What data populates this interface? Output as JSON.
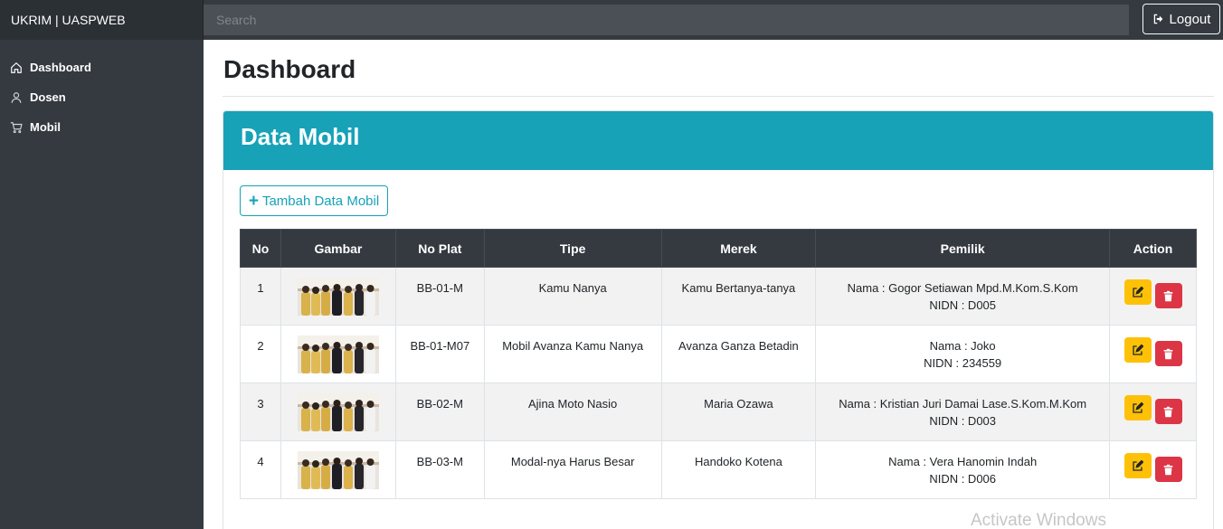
{
  "app": {
    "brand": "UKRIM | UASPWEB"
  },
  "header": {
    "search_placeholder": "Search",
    "logout_label": "Logout"
  },
  "sidebar": {
    "items": [
      {
        "label": "Dashboard",
        "icon": "home-icon"
      },
      {
        "label": "Dosen",
        "icon": "user-icon"
      },
      {
        "label": "Mobil",
        "icon": "cart-icon"
      }
    ]
  },
  "main": {
    "page_title": "Dashboard",
    "card_title": "Data Mobil",
    "add_button_label": "Tambah Data Mobil"
  },
  "table": {
    "headers": [
      "No",
      "Gambar",
      "No Plat",
      "Tipe",
      "Merek",
      "Pemilik",
      "Action"
    ],
    "rows": [
      {
        "no": "1",
        "plat": "BB-01-M",
        "tipe": "Kamu Nanya",
        "merek": "Kamu Bertanya-tanya",
        "nama": "Nama : Gogor Setiawan Mpd.M.Kom.S.Kom",
        "nidn": "NIDN : D005"
      },
      {
        "no": "2",
        "plat": "BB-01-M07",
        "tipe": "Mobil Avanza Kamu Nanya",
        "merek": "Avanza Ganza Betadin",
        "nama": "Nama : Joko",
        "nidn": "NIDN : 234559"
      },
      {
        "no": "3",
        "plat": "BB-02-M",
        "tipe": "Ajina Moto Nasio",
        "merek": "Maria Ozawa",
        "nama": "Nama : Kristian Juri Damai Lase.S.Kom.M.Kom",
        "nidn": "NIDN : D003"
      },
      {
        "no": "4",
        "plat": "BB-03-M",
        "tipe": "Modal-nya Harus Besar",
        "merek": "Handoko Kotena",
        "nama": "Nama : Vera Hanomin Indah",
        "nidn": "NIDN : D006"
      }
    ]
  },
  "watermark": "Activate Windows",
  "colors": {
    "sidebar": "#343a40",
    "card_header": "#17a2b8",
    "edit": "#ffc107",
    "delete": "#dc3545"
  }
}
